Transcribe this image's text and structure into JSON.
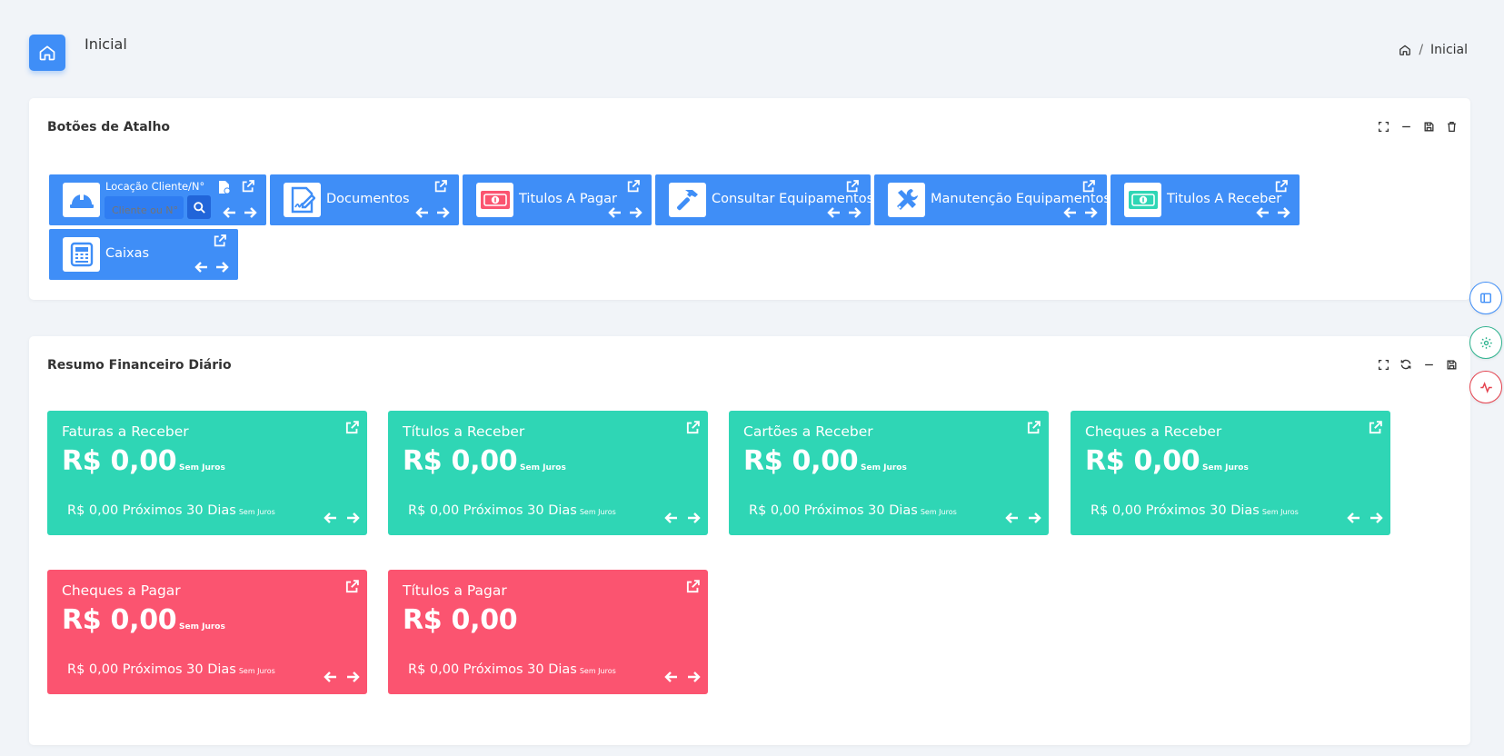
{
  "header": {
    "title": "Inicial",
    "breadcrumb": {
      "current": "Inicial"
    }
  },
  "shortcuts_panel": {
    "title": "Botões de Atalho",
    "locacao": {
      "label": "Locação Cliente/N°",
      "input_placeholder": "Cliente ou N°"
    },
    "buttons": [
      {
        "label": "Documentos",
        "icon": "signature-document-icon"
      },
      {
        "label": "Titulos A Pagar",
        "icon": "money-bill-icon"
      },
      {
        "label": "Consultar Equipamentos",
        "icon": "hammer-icon"
      },
      {
        "label": "Manutenção Equipamentos",
        "icon": "tools-icon"
      },
      {
        "label": "Titulos A Receber",
        "icon": "money-bill-icon"
      },
      {
        "label": "Caixas",
        "icon": "cash-register-icon"
      }
    ]
  },
  "finance_panel": {
    "title": "Resumo Financeiro Diário",
    "cards": [
      {
        "title": "Faturas a Receber",
        "value": "R$ 0,00",
        "juros": "Sem Juros",
        "next": "R$ 0,00 Próximos 30 Dias",
        "next_juros": "Sem Juros",
        "color": "#2fd6b5"
      },
      {
        "title": "Títulos a Receber",
        "value": "R$ 0,00",
        "juros": "Sem Juros",
        "next": "R$ 0,00 Próximos 30 Dias",
        "next_juros": "Sem Juros",
        "color": "#2fd6b5"
      },
      {
        "title": "Cartões a Receber",
        "value": "R$ 0,00",
        "juros": "Sem Juros",
        "next": "R$ 0,00 Próximos 30 Dias",
        "next_juros": "Sem Juros",
        "color": "#2fd6b5"
      },
      {
        "title": "Cheques a Receber",
        "value": "R$ 0,00",
        "juros": "Sem Juros",
        "next": "R$ 0,00 Próximos 30 Dias",
        "next_juros": "Sem Juros",
        "color": "#2fd6b5"
      },
      {
        "title": "Cheques a Pagar",
        "value": "R$ 0,00",
        "juros": "Sem Juros",
        "next": "R$ 0,00 Próximos 30 Dias",
        "next_juros": "Sem Juros",
        "color": "#fb5470"
      },
      {
        "title": "Títulos a Pagar",
        "value": "R$ 0,00",
        "juros": "",
        "next": "R$ 0,00 Próximos 30 Dias",
        "next_juros": "Sem Juros",
        "color": "#fb5470"
      }
    ]
  },
  "colors": {
    "primary": "#3f8ef7",
    "success": "#2fd6b5",
    "danger": "#fb5470",
    "background": "#f1f4f8"
  }
}
